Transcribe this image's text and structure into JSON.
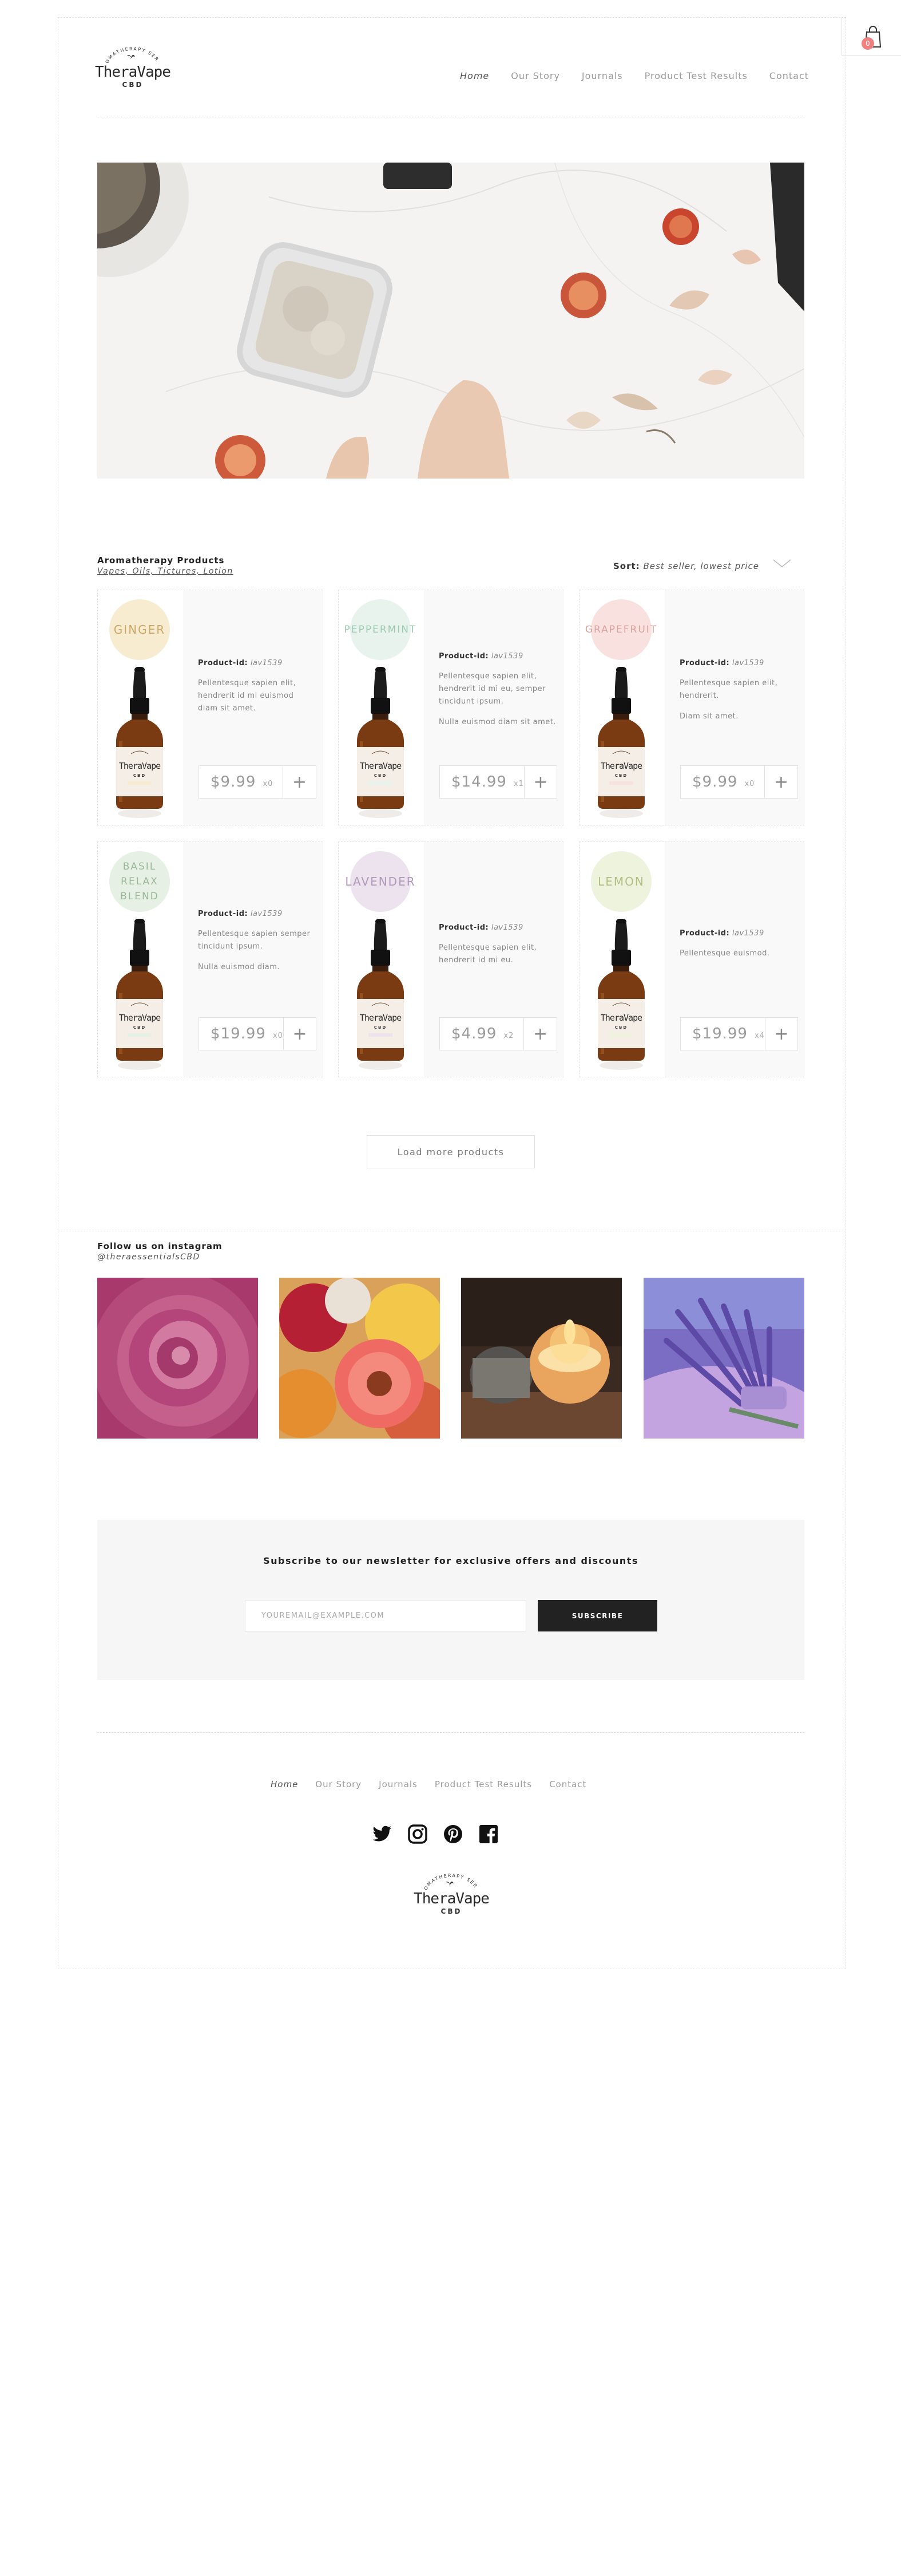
{
  "header": {
    "cart_count": "0",
    "logo": {
      "arc": "AROMATHERAPY SERIES",
      "brand": "TheraVape",
      "sub": "CBD"
    },
    "nav": [
      {
        "label": "Home"
      },
      {
        "label": "Our Story"
      },
      {
        "label": "Journals"
      },
      {
        "label": "Product Test Results"
      },
      {
        "label": "Contact"
      }
    ]
  },
  "products_section": {
    "title": "Aromatherapy Products",
    "subtitle": "Vapes, Oils, Tictures, Lotion",
    "sort_label": "Sort:",
    "sort_value": "Best seller, lowest price"
  },
  "products": [
    {
      "name": "GINGER",
      "circle_color": "#f8ecd0",
      "text_color": "#c9a86a",
      "pid_label": "Product-id:",
      "pid": "lav1539",
      "desc1": "Pellentesque sapien elit, hendrerit id mi euismod diam sit amet.",
      "desc2": "",
      "price": "$9.99",
      "qty": "x0"
    },
    {
      "name": "PEPPERMINT",
      "circle_color": "#e7f3ec",
      "text_color": "#9ccab0",
      "pid_label": "Product-id:",
      "pid": "lav1539",
      "desc1": "Pellentesque sapien elit, hendrerit id mi eu, semper tincidunt ipsum.",
      "desc2": "Nulla euismod diam sit amet.",
      "price": "$14.99",
      "qty": "x1"
    },
    {
      "name": "GRAPEFRUIT",
      "circle_color": "#f8e1df",
      "text_color": "#dba29e",
      "pid_label": "Product-id:",
      "pid": "lav1539",
      "desc1": "Pellentesque sapien elit, hendrerit.",
      "desc2": "Diam sit amet.",
      "price": "$9.99",
      "qty": "x0"
    },
    {
      "name": "BASIL RELAX BLEND",
      "circle_color": "#e6f0e4",
      "text_color": "#9bb89a",
      "pid_label": "Product-id:",
      "pid": "lav1539",
      "desc1": "Pellentesque sapien semper tincidunt ipsum.",
      "desc2": "Nulla euismod diam.",
      "price": "$19.99",
      "qty": "x0"
    },
    {
      "name": "LAVENDER",
      "circle_color": "#ece3ee",
      "text_color": "#b198b8",
      "pid_label": "Product-id:",
      "pid": "lav1539",
      "desc1": "Pellentesque sapien elit, hendrerit id mi eu.",
      "desc2": "",
      "price": "$4.99",
      "qty": "x2"
    },
    {
      "name": "LEMON",
      "circle_color": "#eef3dd",
      "text_color": "#b2bf84",
      "pid_label": "Product-id:",
      "pid": "lav1539",
      "desc1": "Pellentesque euismod.",
      "desc2": "",
      "price": "$19.99",
      "qty": "x4"
    }
  ],
  "load_more": "Load more products",
  "instagram": {
    "title": "Follow us on instagram",
    "handle": "@theraessentialsCBD"
  },
  "newsletter": {
    "title": "Subscribe to our newsletter for exclusive offers and discounts",
    "placeholder": "YOUREMAIL@EXAMPLE.COM",
    "button": "SUBSCRIBE"
  },
  "footer": {
    "nav": [
      {
        "label": "Home"
      },
      {
        "label": "Our Story"
      },
      {
        "label": "Journals"
      },
      {
        "label": "Product Test Results"
      },
      {
        "label": "Contact"
      }
    ],
    "social_icons": [
      "twitter-icon",
      "instagram-icon",
      "pinterest-icon",
      "facebook-icon"
    ],
    "logo": {
      "arc": "AROMATHERAPY SERIES",
      "brand": "TheraVape",
      "sub": "CBD"
    }
  }
}
